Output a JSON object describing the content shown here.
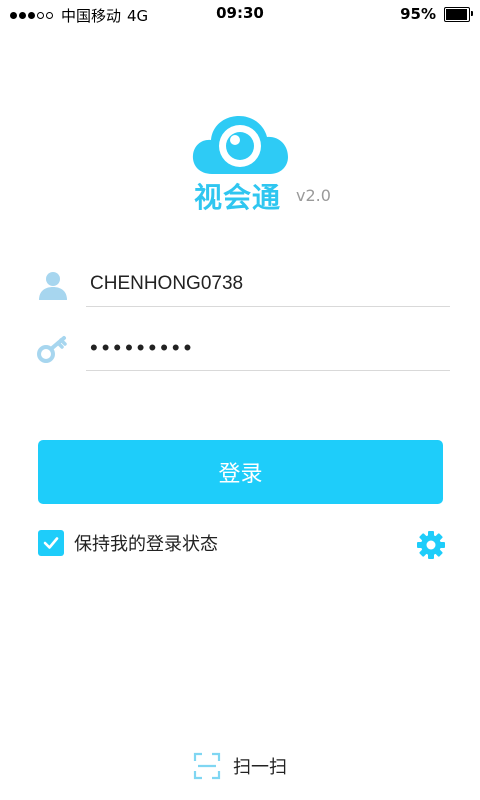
{
  "status_bar": {
    "carrier": "中国移动",
    "network": "4G",
    "time": "09:30",
    "battery": "95%",
    "battery_level": 0.95,
    "signal_bars_filled": 3,
    "signal_bars_total": 5
  },
  "app": {
    "name": "视会通",
    "version": "v2.0"
  },
  "login": {
    "username_value": "CHENHONG0738",
    "password_value": "•••••••••",
    "button_label": "登录",
    "remember_label": "保持我的登录状态",
    "remember_checked": true
  },
  "scan": {
    "label": "扫一扫"
  },
  "colors": {
    "accent": "#1ecdfa",
    "icon_light": "#a7d6ef",
    "version_gray": "#9a9a9a"
  },
  "icons": {
    "user": "user-icon",
    "key": "key-icon",
    "settings": "gear-icon",
    "scan": "scan-icon",
    "logo": "cloud-eye-logo"
  }
}
